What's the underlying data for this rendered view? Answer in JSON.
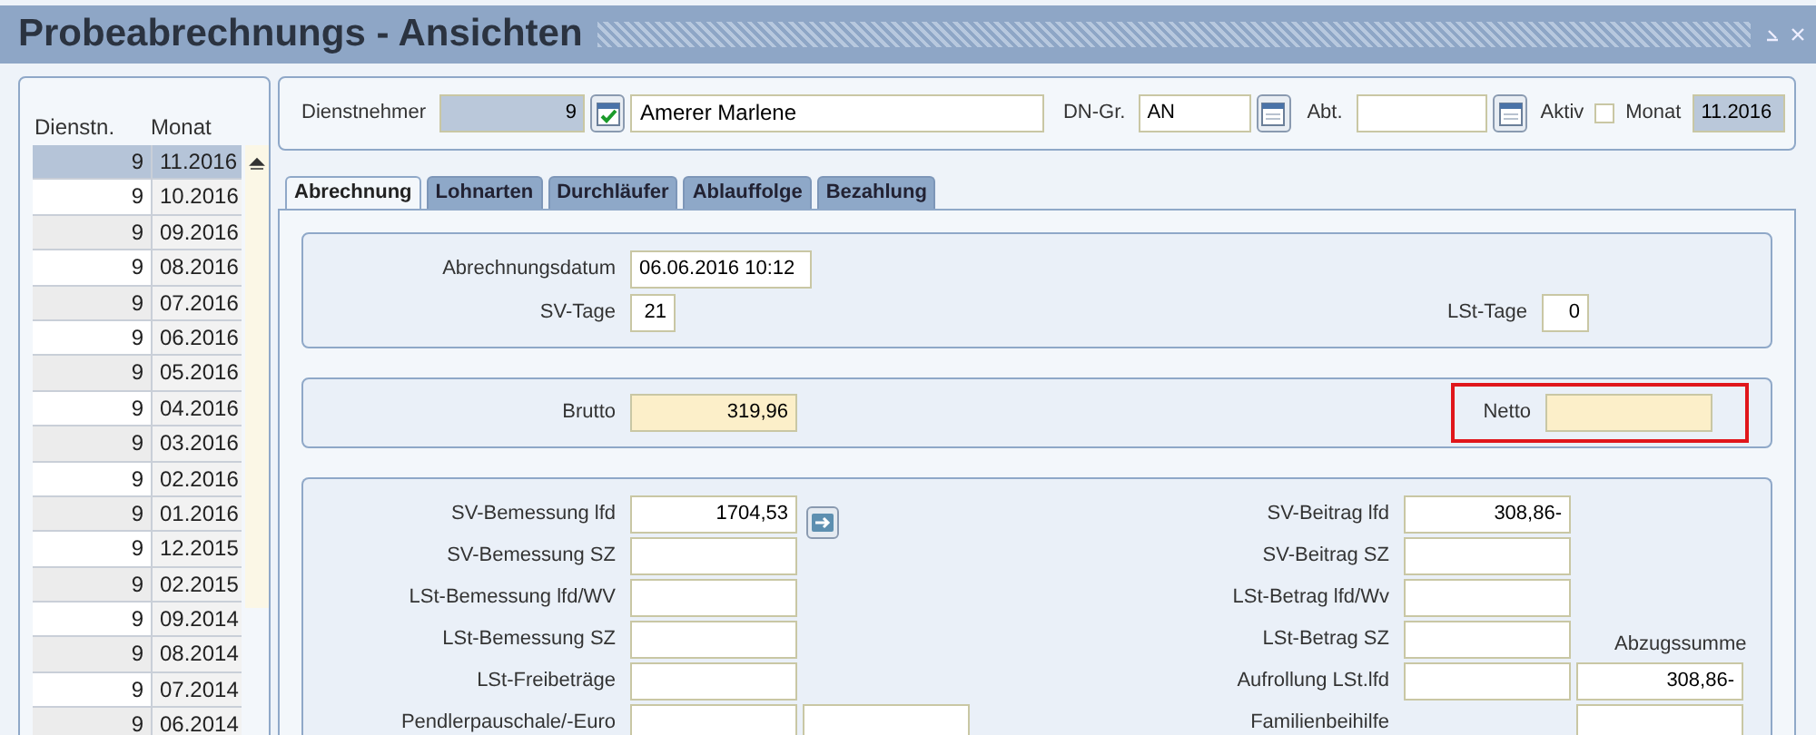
{
  "window": {
    "title": "Probeabrechnungs - Ansichten"
  },
  "list": {
    "columns": [
      "Dienstn.",
      "Monat"
    ],
    "rows": [
      {
        "dienstn": "9",
        "monat": "11.2016",
        "selected": true
      },
      {
        "dienstn": "9",
        "monat": "10.2016",
        "selected": false
      },
      {
        "dienstn": "9",
        "monat": "09.2016",
        "selected": false
      },
      {
        "dienstn": "9",
        "monat": "08.2016",
        "selected": false
      },
      {
        "dienstn": "9",
        "monat": "07.2016",
        "selected": false
      },
      {
        "dienstn": "9",
        "monat": "06.2016",
        "selected": false
      },
      {
        "dienstn": "9",
        "monat": "05.2016",
        "selected": false
      },
      {
        "dienstn": "9",
        "monat": "04.2016",
        "selected": false
      },
      {
        "dienstn": "9",
        "monat": "03.2016",
        "selected": false
      },
      {
        "dienstn": "9",
        "monat": "02.2016",
        "selected": false
      },
      {
        "dienstn": "9",
        "monat": "01.2016",
        "selected": false
      },
      {
        "dienstn": "9",
        "monat": "12.2015",
        "selected": false
      },
      {
        "dienstn": "9",
        "monat": "02.2015",
        "selected": false
      },
      {
        "dienstn": "9",
        "monat": "09.2014",
        "selected": false
      },
      {
        "dienstn": "9",
        "monat": "08.2014",
        "selected": false
      },
      {
        "dienstn": "9",
        "monat": "07.2014",
        "selected": false
      },
      {
        "dienstn": "9",
        "monat": "06.2014",
        "selected": false
      }
    ]
  },
  "header": {
    "dienstnehmer_label": "Dienstnehmer",
    "dienstnehmer_nr": "9",
    "dienstnehmer_name": "Amerer Marlene",
    "dn_gr_label": "DN-Gr.",
    "dn_gr": "AN",
    "abt_label": "Abt.",
    "aktiv_label": "Aktiv",
    "aktiv_checked": false,
    "monat_label": "Monat",
    "monat": "11.2016"
  },
  "tabs": [
    {
      "label": "Abrechnung",
      "selected": true
    },
    {
      "label": "Lohnarten",
      "selected": false
    },
    {
      "label": "Durchläufer",
      "selected": false
    },
    {
      "label": "Ablauffolge",
      "selected": false
    },
    {
      "label": "Bezahlung",
      "selected": false
    }
  ],
  "abrechnung": {
    "datum_label": "Abrechnungsdatum",
    "datum": "06.06.2016 10:12",
    "sv_tage_label": "SV-Tage",
    "sv_tage": "21",
    "lst_tage_label": "LSt-Tage",
    "lst_tage": "0",
    "brutto_label": "Brutto",
    "brutto": "319,96",
    "netto_label": "Netto",
    "netto_highlighted": true,
    "left_rows": [
      {
        "label": "SV-Bemessung lfd",
        "value": "1704,53"
      },
      {
        "label": "SV-Bemessung SZ"
      },
      {
        "label": "LSt-Bemessung lfd/WV"
      },
      {
        "label": "LSt-Bemessung SZ"
      },
      {
        "label": "LSt-Freibeträge"
      },
      {
        "label": "Pendlerpauschale/-Euro",
        "extra_field": true
      }
    ],
    "right_rows": [
      {
        "label": "SV-Beitrag lfd",
        "value": "308,86-"
      },
      {
        "label": "SV-Beitrag SZ"
      },
      {
        "label": "LSt-Betrag lfd/Wv"
      },
      {
        "label": "LSt-Betrag SZ"
      },
      {
        "label": "Aufrollung LSt.lfd"
      },
      {
        "label": "Familienbeihilfe",
        "no_main_field": true
      }
    ],
    "abzugssumme_label": "Abzugssumme",
    "abzugssumme": "308,86-"
  }
}
